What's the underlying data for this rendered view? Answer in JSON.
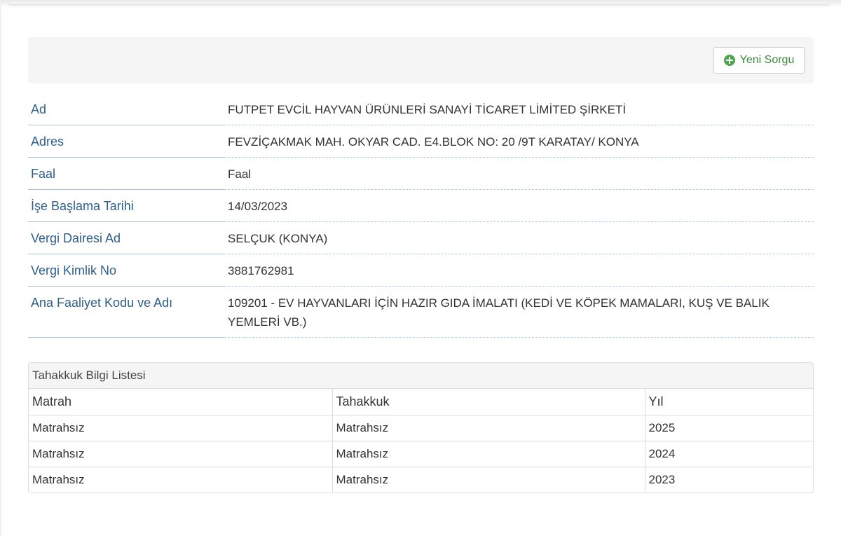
{
  "toolbar": {
    "new_query_label": "Yeni Sorgu"
  },
  "info": [
    {
      "label": "Ad",
      "value": "FUTPET EVCİL HAYVAN ÜRÜNLERİ SANAYİ TİCARET LİMİTED ŞİRKETİ"
    },
    {
      "label": "Adres",
      "value": "FEVZİÇAKMAK MAH. OKYAR CAD. E4.BLOK NO: 20 /9T KARATAY/ KONYA"
    },
    {
      "label": "Faal",
      "value": "Faal"
    },
    {
      "label": "İşe Başlama Tarihi",
      "value": "14/03/2023"
    },
    {
      "label": "Vergi Dairesi Ad",
      "value": "SELÇUK (KONYA)"
    },
    {
      "label": "Vergi Kimlik No",
      "value": "3881762981"
    },
    {
      "label": "Ana Faaliyet Kodu ve Adı",
      "value": "109201 - EV HAYVANLARI İÇİN HAZIR GIDA İMALATI (KEDİ VE KÖPEK MAMALARI, KUŞ VE BALIK YEMLERİ VB.)"
    }
  ],
  "accrual": {
    "title": "Tahakkuk Bilgi Listesi",
    "columns": [
      "Matrah",
      "Tahakkuk",
      "Yıl"
    ],
    "rows": [
      [
        "Matrahsız",
        "Matrahsız",
        "2025"
      ],
      [
        "Matrahsız",
        "Matrahsız",
        "2024"
      ],
      [
        "Matrahsız",
        "Matrahsız",
        "2023"
      ]
    ]
  },
  "colors": {
    "label": "#2e5f8a",
    "button_text": "#3a8a3a",
    "button_icon": "#4ca64c"
  }
}
